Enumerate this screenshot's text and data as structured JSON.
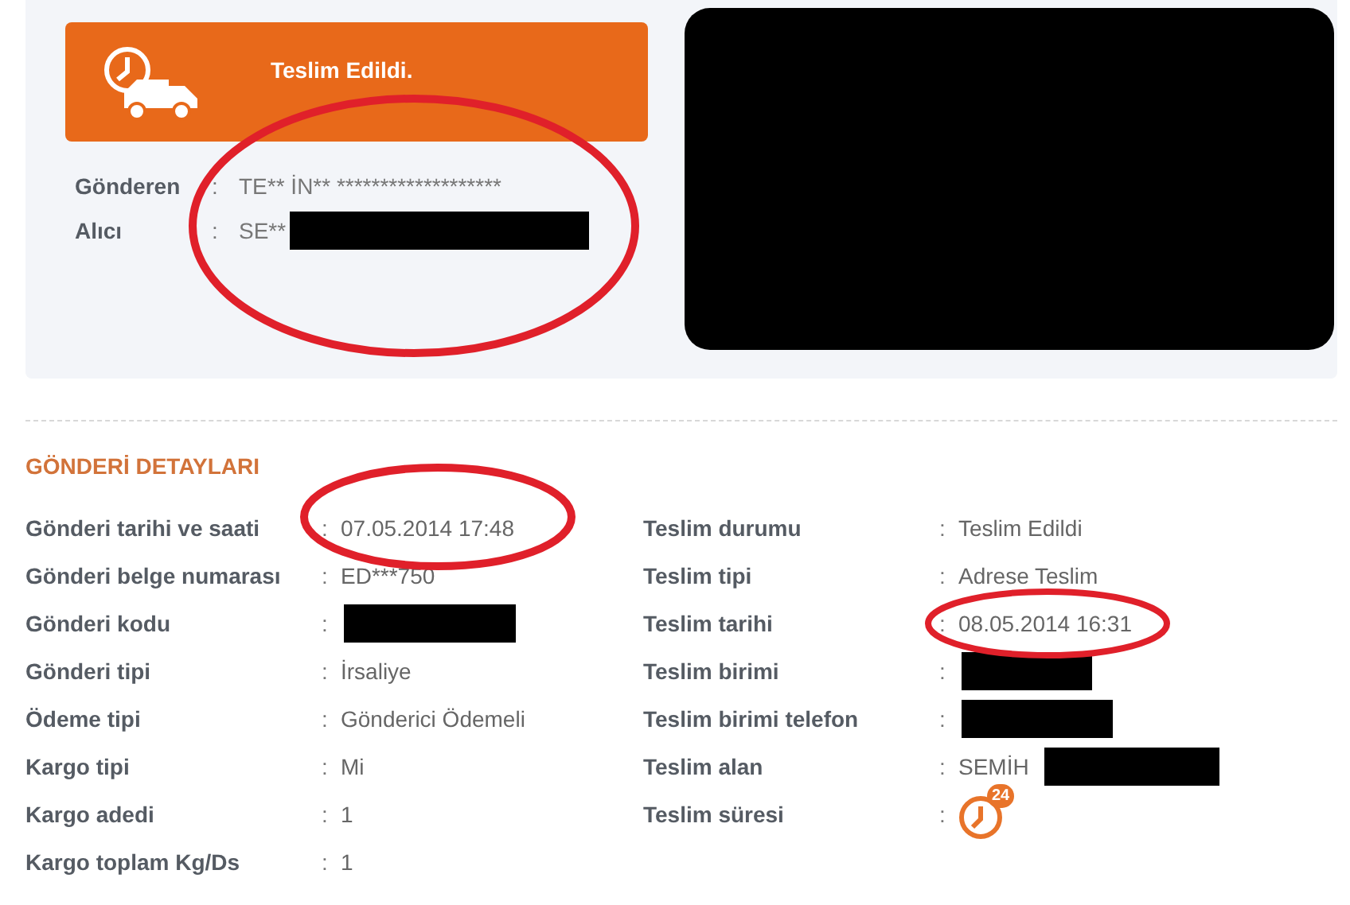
{
  "status_card": {
    "title": "Teslim Edildi."
  },
  "parties": [
    {
      "label": "Gönderen",
      "sep": ":",
      "value": "TE** İN** *******************",
      "redacted": false
    },
    {
      "label": "Alıcı",
      "sep": ":",
      "value": "SE**",
      "redacted": true
    }
  ],
  "map_panel": {
    "redacted": true
  },
  "section_title": "GÖNDERİ DETAYLARI",
  "left_rows": [
    {
      "label": "Gönderi tarihi ve saati",
      "sep": ":",
      "value": "07.05.2014 17:48",
      "redacted": false
    },
    {
      "label": "Gönderi belge numarası",
      "sep": ":",
      "value": "ED***750",
      "redacted": false
    },
    {
      "label": "Gönderi kodu",
      "sep": ":",
      "redacted": true
    },
    {
      "label": "Gönderi tipi",
      "sep": ":",
      "value": "İrsaliye",
      "redacted": false
    },
    {
      "label": "Ödeme tipi",
      "sep": ":",
      "value": "Gönderici Ödemeli",
      "redacted": false
    },
    {
      "label": "Kargo tipi",
      "sep": ":",
      "value": "Mi",
      "redacted": false
    },
    {
      "label": "Kargo adedi",
      "sep": ":",
      "value": "1",
      "redacted": false
    },
    {
      "label": "Kargo toplam Kg/Ds",
      "sep": ":",
      "value": "1",
      "redacted": false
    }
  ],
  "right_rows": [
    {
      "label": "Teslim durumu",
      "sep": ":",
      "value": "Teslim Edildi",
      "redacted": false,
      "kind": "text"
    },
    {
      "label": "Teslim tipi",
      "sep": ":",
      "value": "Adrese Teslim",
      "redacted": false,
      "kind": "text"
    },
    {
      "label": "Teslim tarihi",
      "sep": ":",
      "value": "08.05.2014 16:31",
      "redacted": false,
      "kind": "text"
    },
    {
      "label": "Teslim birimi",
      "sep": ":",
      "redacted": true,
      "kind": "text"
    },
    {
      "label": "Teslim birimi telefon",
      "sep": ":",
      "redacted": true,
      "kind": "text"
    },
    {
      "label": "Teslim alan",
      "sep": ":",
      "value": "SEMİH",
      "redacted": true,
      "kind": "text"
    },
    {
      "label": "Teslim süresi",
      "sep": ":",
      "badge": "24",
      "kind": "icon"
    }
  ]
}
